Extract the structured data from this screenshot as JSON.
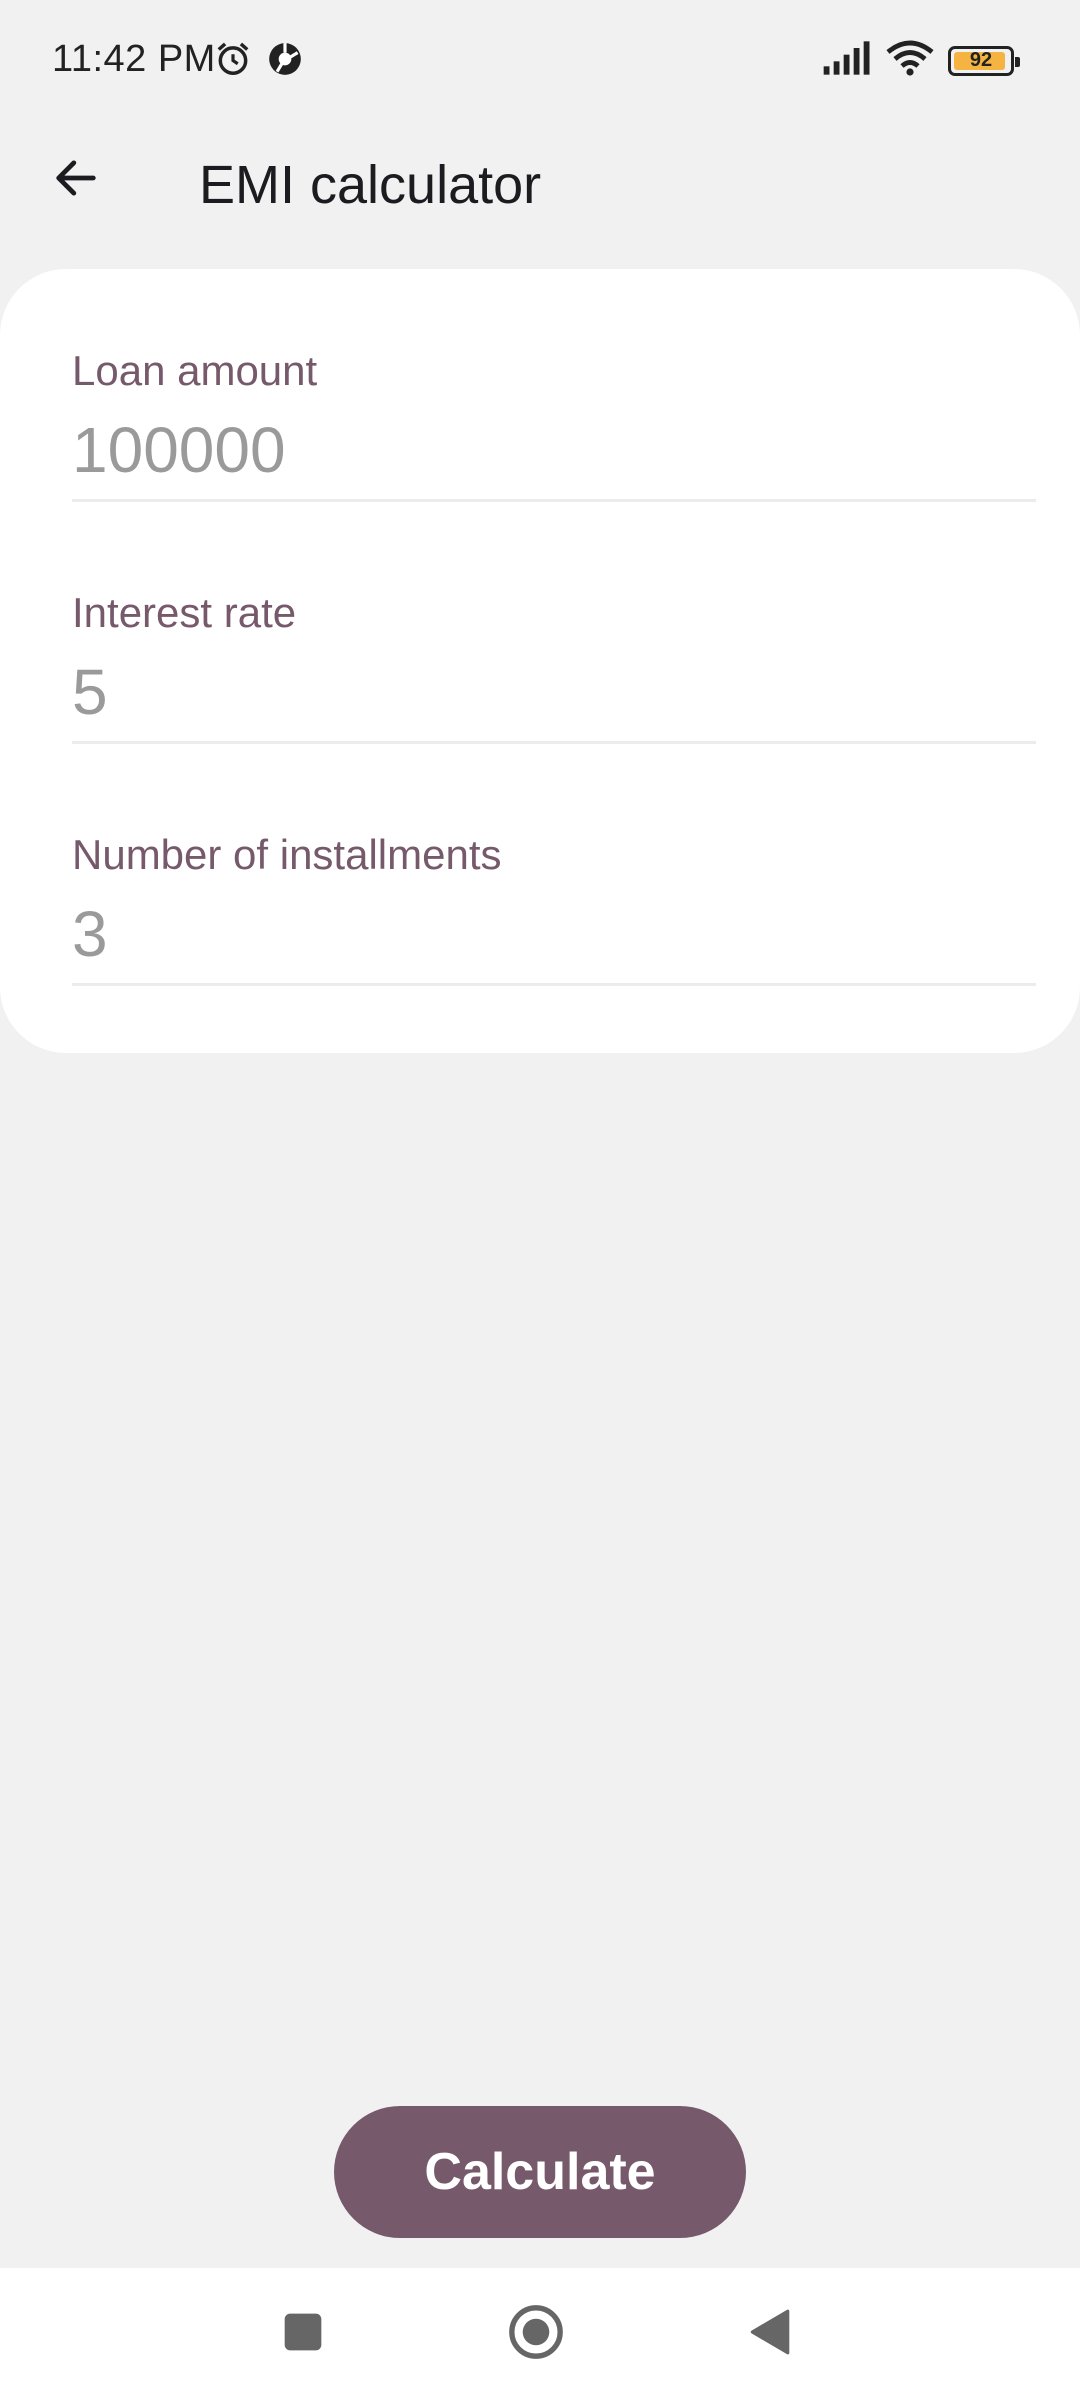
{
  "status_bar": {
    "time": "11:42 PM",
    "battery_level": "92",
    "battery_color": "#f5b342",
    "icons": [
      "alarm-icon",
      "vpn-icon",
      "signal-icon",
      "wifi-icon",
      "battery-icon"
    ]
  },
  "app_bar": {
    "title": "EMI calculator",
    "back_icon": "arrow-left-icon"
  },
  "form": {
    "fields": [
      {
        "label": "Loan amount",
        "placeholder": "100000",
        "value": ""
      },
      {
        "label": "Interest rate",
        "placeholder": "5",
        "value": ""
      },
      {
        "label": "Number of installments",
        "placeholder": "3",
        "value": ""
      }
    ]
  },
  "actions": {
    "calculate_label": "Calculate"
  },
  "nav_bar": {
    "icons": [
      "recents-square-icon",
      "home-circle-icon",
      "back-triangle-icon"
    ]
  },
  "colors": {
    "accent": "#76596b",
    "background": "#f1f1f2",
    "card": "#ffffff",
    "placeholder": "#9a9a9a"
  }
}
